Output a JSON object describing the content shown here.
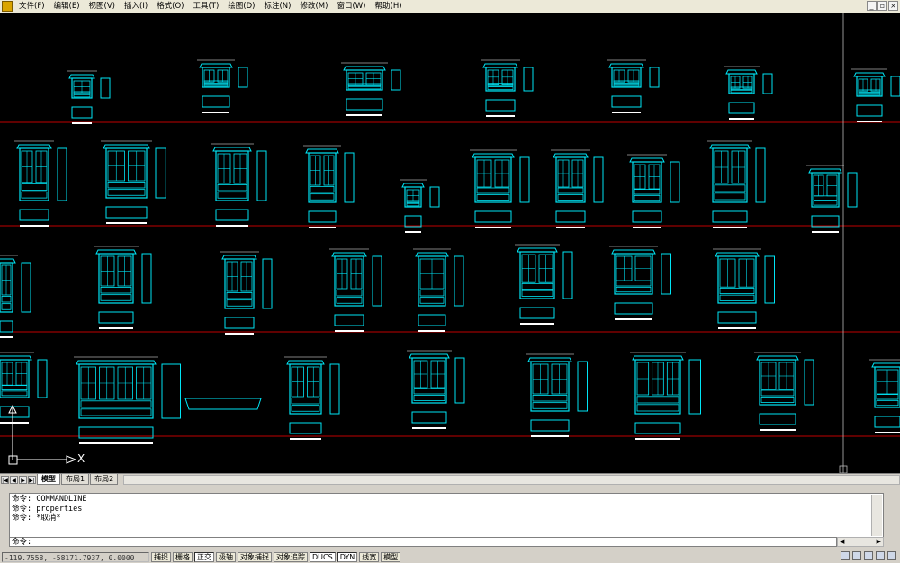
{
  "menubar": {
    "items": [
      "文件(F)",
      "编辑(E)",
      "视图(V)",
      "插入(I)",
      "格式(O)",
      "工具(T)",
      "绘图(D)",
      "标注(N)",
      "修改(M)",
      "窗口(W)",
      "帮助(H)"
    ],
    "window_buttons": [
      "_",
      "▫",
      "×"
    ]
  },
  "layout_tabs": {
    "nav": [
      "|◀",
      "◀",
      "▶",
      "▶|"
    ],
    "tabs": [
      "模型",
      "布局1",
      "布局2"
    ],
    "active": "模型"
  },
  "ucs_icon": {
    "x_label": "X"
  },
  "command": {
    "history": [
      "命令: COMMANDLINE",
      "命令: properties",
      "命令: *取消*"
    ],
    "prompt": "命令:",
    "scroll_arrows": [
      "◀",
      "▶"
    ]
  },
  "statusbar": {
    "coordinates": "-119.7558, -58171.7937, 0.0000",
    "toggles": [
      {
        "label": "捕捉",
        "on": false
      },
      {
        "label": "栅格",
        "on": false
      },
      {
        "label": "正交",
        "on": true
      },
      {
        "label": "极轴",
        "on": false
      },
      {
        "label": "对象捕捉",
        "on": false
      },
      {
        "label": "对象追踪",
        "on": false
      },
      {
        "label": "DUCS",
        "on": true
      },
      {
        "label": "DYN",
        "on": true
      },
      {
        "label": "线宽",
        "on": false
      },
      {
        "label": "模型",
        "on": false
      }
    ]
  },
  "colors": {
    "drawing": "#00e5f5",
    "divider": "#c00000",
    "background": "#000000",
    "annotation": "#ffffff"
  }
}
